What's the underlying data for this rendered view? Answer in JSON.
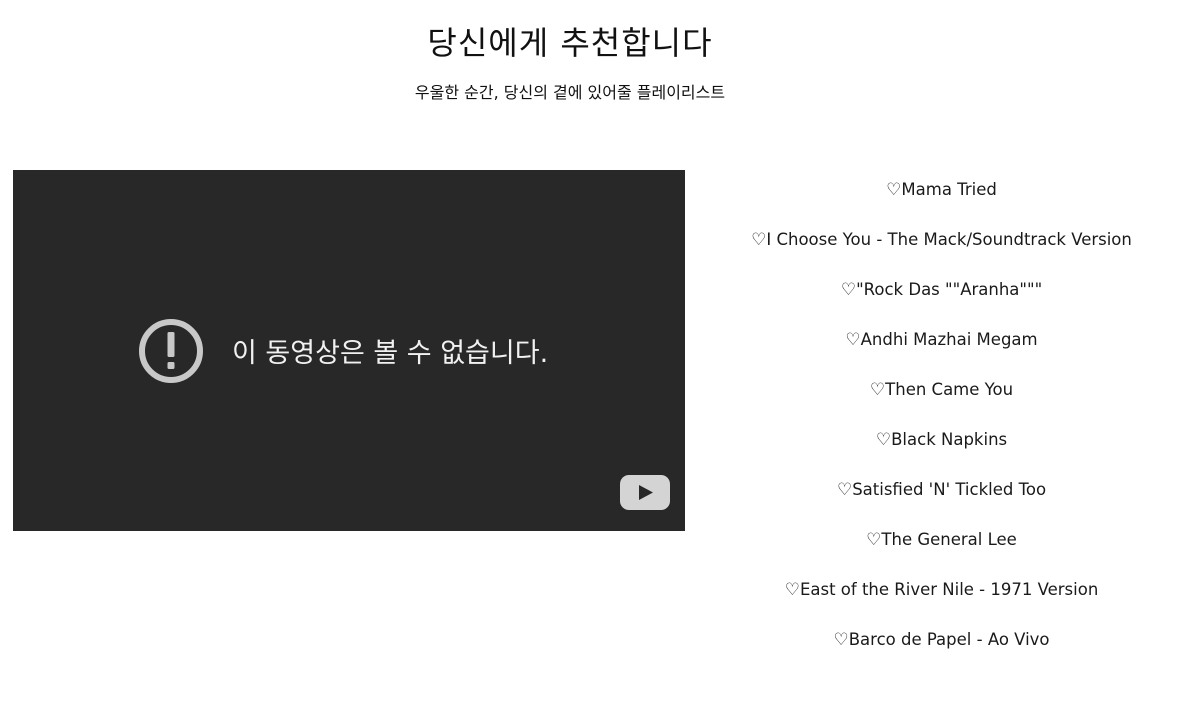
{
  "header": {
    "title": "당신에게 추천합니다",
    "subtitle": "우울한 순간, 당신의 곁에 있어줄 플레이리스트"
  },
  "video": {
    "error_message": "이 동영상은 볼 수 없습니다.",
    "background_color": "#282828",
    "icons": [
      "alert-circle-icon",
      "youtube-logo-icon"
    ]
  },
  "playlist": {
    "heart_symbol": "♡",
    "items": [
      "Mama Tried",
      "I Choose You - The Mack/Soundtrack Version",
      "\"Rock Das \"\"Aranha\"\"\"",
      "Andhi Mazhai Megam",
      "Then Came You",
      "Black Napkins",
      "Satisfied 'N' Tickled Too",
      "The General Lee",
      "East of the River Nile - 1971 Version",
      "Barco de Papel - Ao Vivo"
    ]
  }
}
